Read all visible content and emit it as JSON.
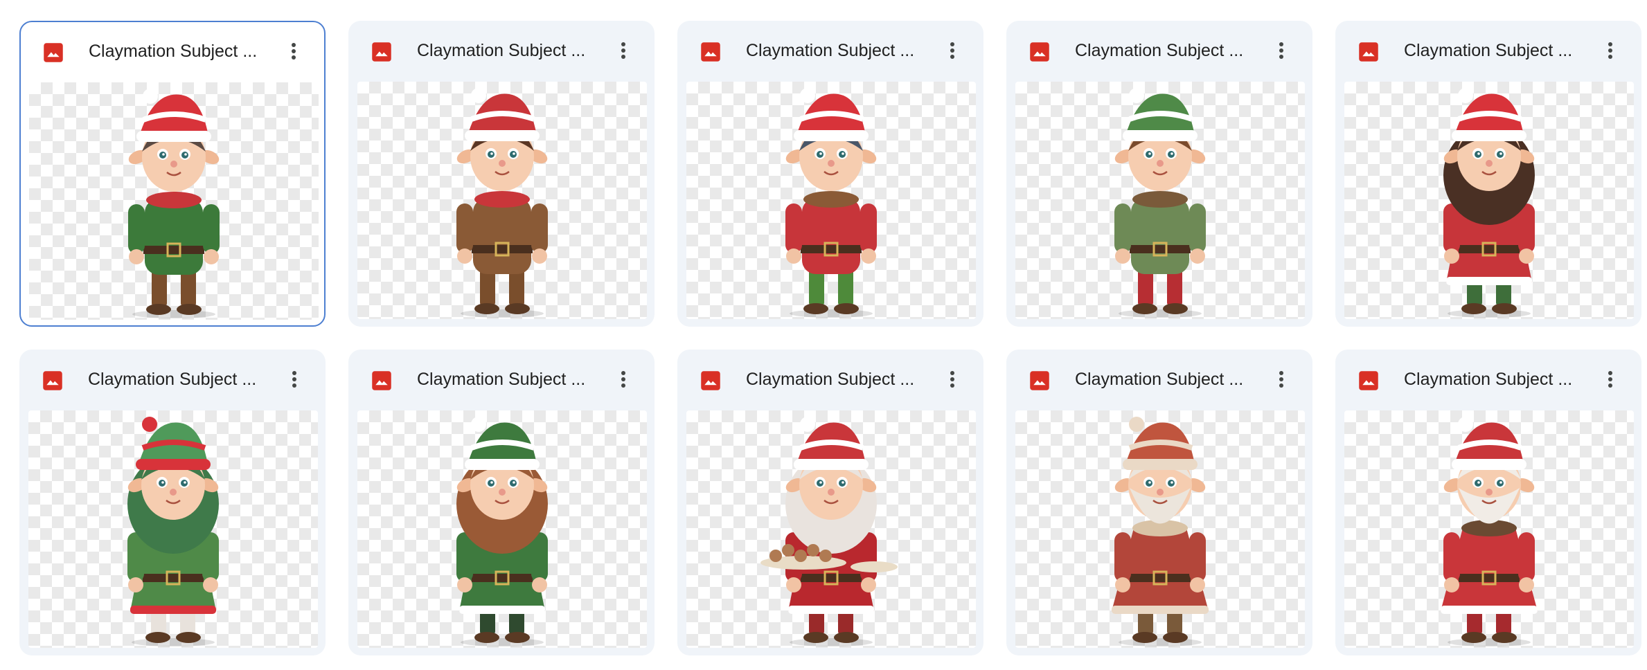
{
  "files": [
    {
      "name": "Claymation Subject ...",
      "figure": "elf-boy-red-hat",
      "selected": true,
      "colors": {
        "hat": "#d8333a",
        "stripe": "#ffffff",
        "hair": "#5b4a43",
        "body": "#3c7a3a",
        "pants": "#7a4e2c",
        "accent": "#c9363a"
      }
    },
    {
      "name": "Claymation Subject ...",
      "figure": "elf-boy-laughing",
      "selected": false,
      "colors": {
        "hat": "#c9363a",
        "stripe": "#ffffff",
        "hair": "#5a3624",
        "body": "#8a5a36",
        "pants": "#7a4e2c",
        "accent": "#c9363a"
      }
    },
    {
      "name": "Claymation Subject ...",
      "figure": "elf-boy-green-coat",
      "selected": false,
      "colors": {
        "hat": "#d8333a",
        "stripe": "#ffffff",
        "hair": "#4a5668",
        "body": "#c7353a",
        "pants": "#4e8a3a",
        "accent": "#8a5a36"
      }
    },
    {
      "name": "Claymation Subject ...",
      "figure": "elf-boy-green-hat",
      "selected": false,
      "colors": {
        "hat": "#4f8a48",
        "stripe": "#ffffff",
        "hair": "#7a4a2c",
        "body": "#6e8a56",
        "pants": "#b72e33",
        "accent": "#7a5a3a"
      }
    },
    {
      "name": "Claymation Subject ...",
      "figure": "elf-girl-red-dress",
      "selected": false,
      "colors": {
        "hat": "#d8333a",
        "stripe": "#ffffff",
        "hair": "#4a3024",
        "body": "#c7353a",
        "pants": "#3e6e3a",
        "accent": "#ffffff"
      }
    },
    {
      "name": "Claymation Subject ...",
      "figure": "elf-girl-green-hair",
      "selected": false,
      "colors": {
        "hat": "#4f9a5a",
        "stripe": "#d8333a",
        "hair": "#3f7a4a",
        "body": "#4f8a48",
        "pants": "#e8e2dc",
        "accent": "#c9363a"
      }
    },
    {
      "name": "Claymation Subject ...",
      "figure": "elf-girl-striped",
      "selected": false,
      "colors": {
        "hat": "#3e7a3e",
        "stripe": "#ffffff",
        "hair": "#9a5a36",
        "body": "#3e7a3e",
        "pants": "#2f4a2f",
        "accent": "#c9363a"
      }
    },
    {
      "name": "Claymation Subject ...",
      "figure": "mrs-claus-cookies",
      "selected": false,
      "colors": {
        "hat": "#c9363a",
        "stripe": "#ffffff",
        "hair": "#e9e3de",
        "body": "#b9282e",
        "pants": "#9a2a2a",
        "accent": "#8a5a36"
      }
    },
    {
      "name": "Claymation Subject ...",
      "figure": "santa-long-coat",
      "selected": false,
      "colors": {
        "hat": "#c0553e",
        "stripe": "#ead9c6",
        "hair": "#ece5dc",
        "body": "#b3463a",
        "pants": "#7a5a3a",
        "accent": "#d9c3a6"
      }
    },
    {
      "name": "Claymation Subject ...",
      "figure": "santa-classic",
      "selected": false,
      "colors": {
        "hat": "#c9363a",
        "stripe": "#ffffff",
        "hair": "#f1ece6",
        "body": "#c9363a",
        "pants": "#a62a2e",
        "accent": "#6a4a32"
      }
    }
  ],
  "icons": {
    "file_type": "image-file-icon",
    "menu": "more-vertical-icon"
  },
  "theme": {
    "file_icon_color": "#d93025",
    "card_bg": "#f0f4f9",
    "selected_border": "#4d7fd1"
  }
}
